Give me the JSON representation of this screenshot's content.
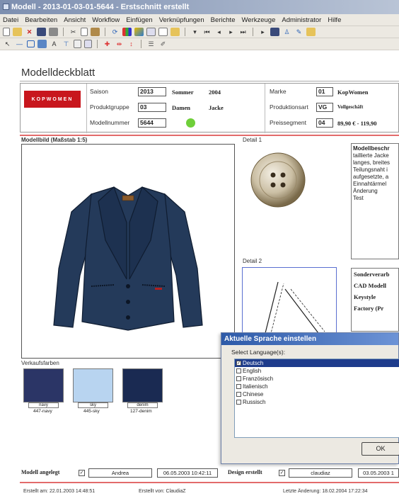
{
  "window": {
    "title": "Modell - 2013-01-03-01-5644 - Erstschnitt erstellt"
  },
  "menu": [
    "Datei",
    "Bearbeiten",
    "Ansicht",
    "Workflow",
    "Einfügen",
    "Verknüpfungen",
    "Berichte",
    "Werkzeuge",
    "Administrator",
    "Hilfe"
  ],
  "page": {
    "title": "Modelldeckblatt"
  },
  "header": {
    "logo_text": "KOPWOMEN",
    "saison_label": "Saison",
    "saison_value": "2013",
    "saison_name": "Sommer",
    "saison_year": "2004",
    "produktgruppe_label": "Produktgruppe",
    "produktgruppe_value": "03",
    "produktgruppe_name": "Damen",
    "produktgruppe_type": "Jacke",
    "modellnummer_label": "Modellnummer",
    "modellnummer_value": "5644",
    "status_color": "#6fcf3a",
    "marke_label": "Marke",
    "marke_value": "01",
    "marke_name": "KopWomen",
    "produktionsart_label": "Produktionsart",
    "produktionsart_value": "VG",
    "produktionsart_name": "Vollgeschäft",
    "preissegment_label": "Preissegment",
    "preissegment_value": "04",
    "preissegment_name": "89,90 € - 119,90"
  },
  "sections": {
    "modellbild_label": "Modellbild (Maßstab 1:5)",
    "detail1_label": "Detail 1",
    "detail2_label": "Detail 2",
    "verkaufsfarben_label": "Verkaufsfarben"
  },
  "description": {
    "heading": "Modellbeschr",
    "lines": [
      "taillierte Jacke",
      "langes, breites",
      "Teilungsnaht i",
      "aufgesetzte, a",
      "Einnahtärmel",
      "Änderung",
      "Test"
    ]
  },
  "sonderverarbeitung": [
    "Sonderverarb",
    "CAD Modell",
    "Keystyle",
    "Factory (Pr"
  ],
  "colors": [
    {
      "name": "navy",
      "code": "447-navy",
      "hex": "#2b3566"
    },
    {
      "name": "sky",
      "code": "445-sky",
      "hex": "#b8d4f0"
    },
    {
      "name": "denim",
      "code": "127-denim",
      "hex": "#1a2a52"
    }
  ],
  "dialog": {
    "title": "Aktuelle Sprache einstellen",
    "prompt": "Select Language(s):",
    "languages": [
      {
        "label": "Deutsch",
        "checked": true,
        "selected": true
      },
      {
        "label": "English",
        "checked": false,
        "selected": false
      },
      {
        "label": "Französisch",
        "checked": false,
        "selected": false
      },
      {
        "label": "Italienisch",
        "checked": false,
        "selected": false
      },
      {
        "label": "Chinese",
        "checked": false,
        "selected": false
      },
      {
        "label": "Russisch",
        "checked": false,
        "selected": false
      }
    ],
    "ok_label": "OK"
  },
  "footer": {
    "modell_angelegt_label": "Modell angelegt",
    "modell_angelegt_checked": "✓",
    "modell_angelegt_user": "Andrea",
    "modell_angelegt_date": "06.05.2003 10:42:11",
    "design_erstellt_label": "Design erstellt",
    "design_erstellt_checked": "✓",
    "design_erstellt_user": "claudiaz",
    "design_erstellt_date": "03.05.2003 1",
    "erstellt_am": "Erstellt am: 22.01.2003 14:48:51",
    "erstellt_von": "Erstellt von: ClaudiaZ",
    "letzte_aenderung": "Letzte Änderung: 18.02.2004 17:22:34"
  }
}
